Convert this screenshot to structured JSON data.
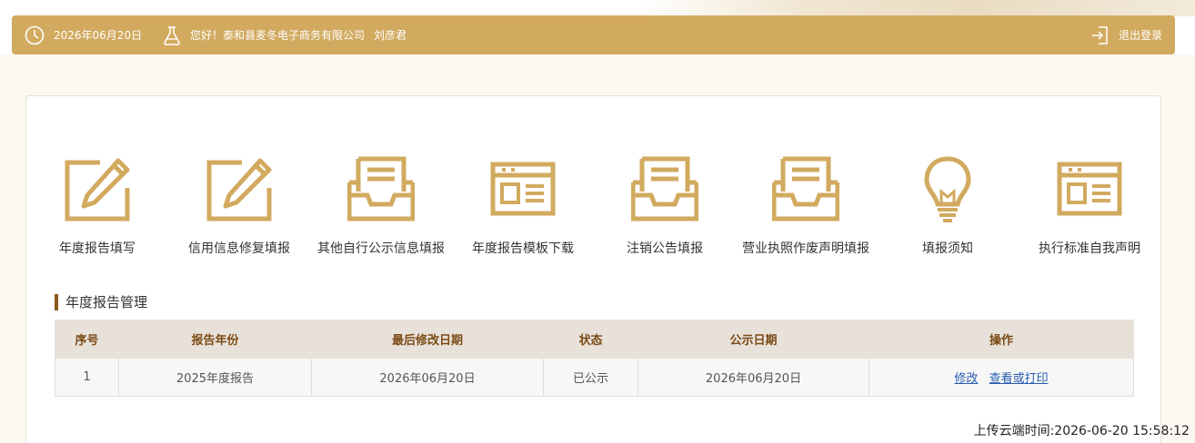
{
  "header": {
    "date": "2026年06月20日",
    "greeting": "您好！泰和县麦冬电子商务有限公司",
    "user": "刘彦君",
    "logout_label": "退出登录"
  },
  "functions": [
    {
      "label": "年度报告填写",
      "icon": "edit-icon"
    },
    {
      "label": "信用信息修复填报",
      "icon": "edit-icon"
    },
    {
      "label": "其他自行公示信息填报",
      "icon": "inbox-icon"
    },
    {
      "label": "年度报告模板下载",
      "icon": "template-icon"
    },
    {
      "label": "注销公告填报",
      "icon": "inbox-icon"
    },
    {
      "label": "营业执照作废声明填报",
      "icon": "inbox-icon"
    },
    {
      "label": "填报须知",
      "icon": "lightbulb-icon"
    },
    {
      "label": "执行标准自我声明",
      "icon": "template-icon"
    }
  ],
  "section": {
    "title": "年度报告管理"
  },
  "table": {
    "headers": [
      "序号",
      "报告年份",
      "最后修改日期",
      "状态",
      "公示日期",
      "操作"
    ],
    "rows": [
      {
        "index": "1",
        "year": "2025年度报告",
        "modified": "2026年06月20日",
        "status": "已公示",
        "publish": "2026年06月20日",
        "actions": [
          "修改",
          "查看或打印"
        ]
      }
    ]
  },
  "footer": {
    "upload_time": "上传云端时间:2026-06-20 15:58:12"
  },
  "colors": {
    "accent": "#d2aa5f",
    "header_text": "#7a4a14",
    "link": "#2a5db0"
  }
}
